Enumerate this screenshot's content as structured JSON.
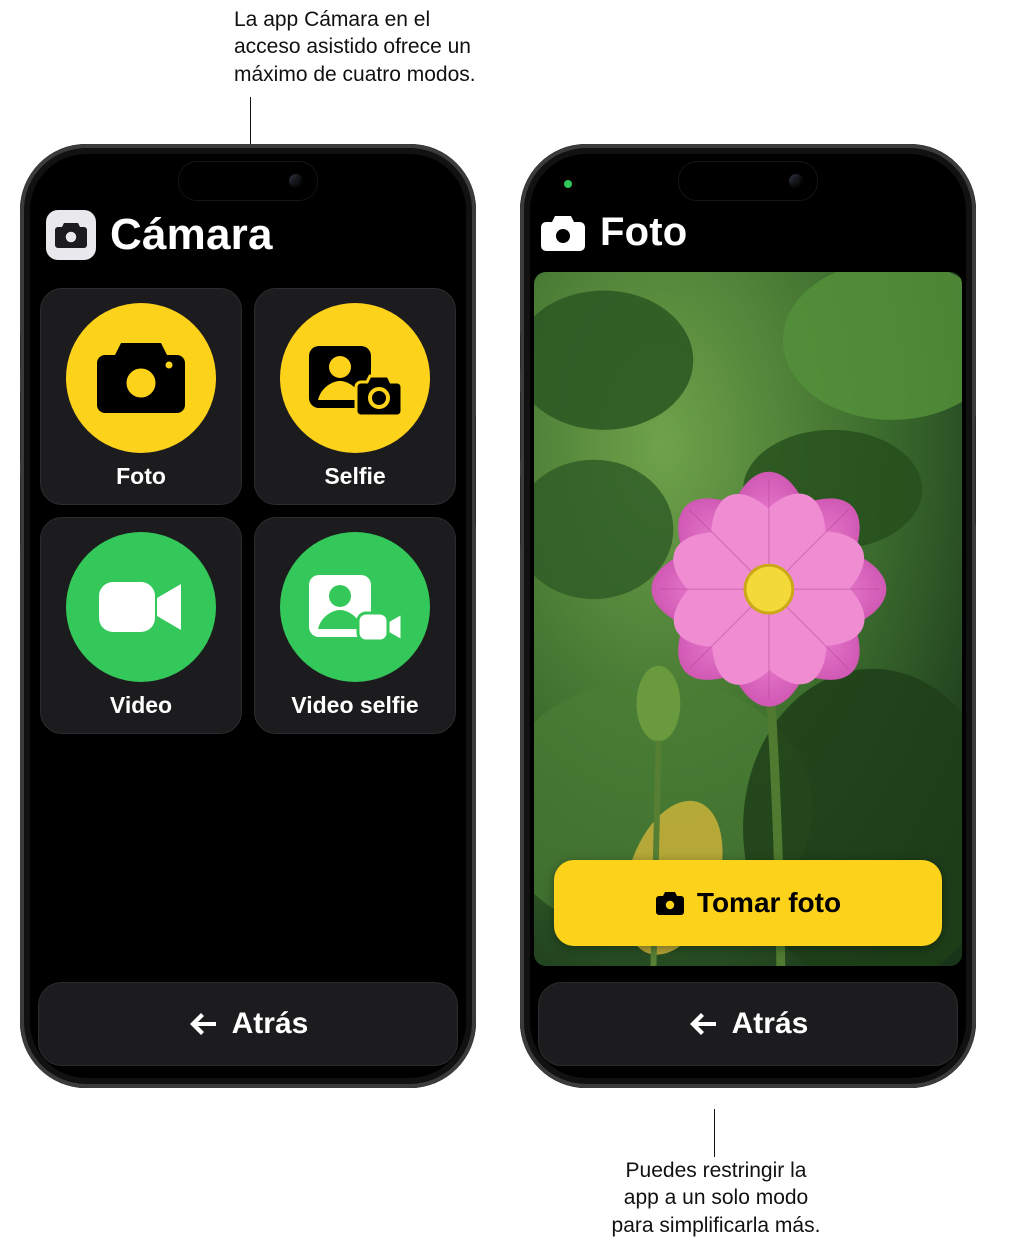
{
  "callouts": {
    "top": "La app Cámara en el\nacceso asistido ofrece un\nmáximo de cuatro modos.",
    "bottom": "Puedes restringir la\napp a un solo modo\npara simplificarla más."
  },
  "left_phone": {
    "title": "Cámara",
    "modes": [
      {
        "label": "Foto",
        "icon": "camera",
        "color": "#fcd21a"
      },
      {
        "label": "Selfie",
        "icon": "selfie",
        "color": "#fcd21a"
      },
      {
        "label": "Video",
        "icon": "video",
        "color": "#34c759"
      },
      {
        "label": "Video selfie",
        "icon": "selfie-video",
        "color": "#34c759"
      }
    ],
    "back_label": "Atrás"
  },
  "right_phone": {
    "title": "Foto",
    "shutter_label": "Tomar foto",
    "back_label": "Atrás"
  }
}
